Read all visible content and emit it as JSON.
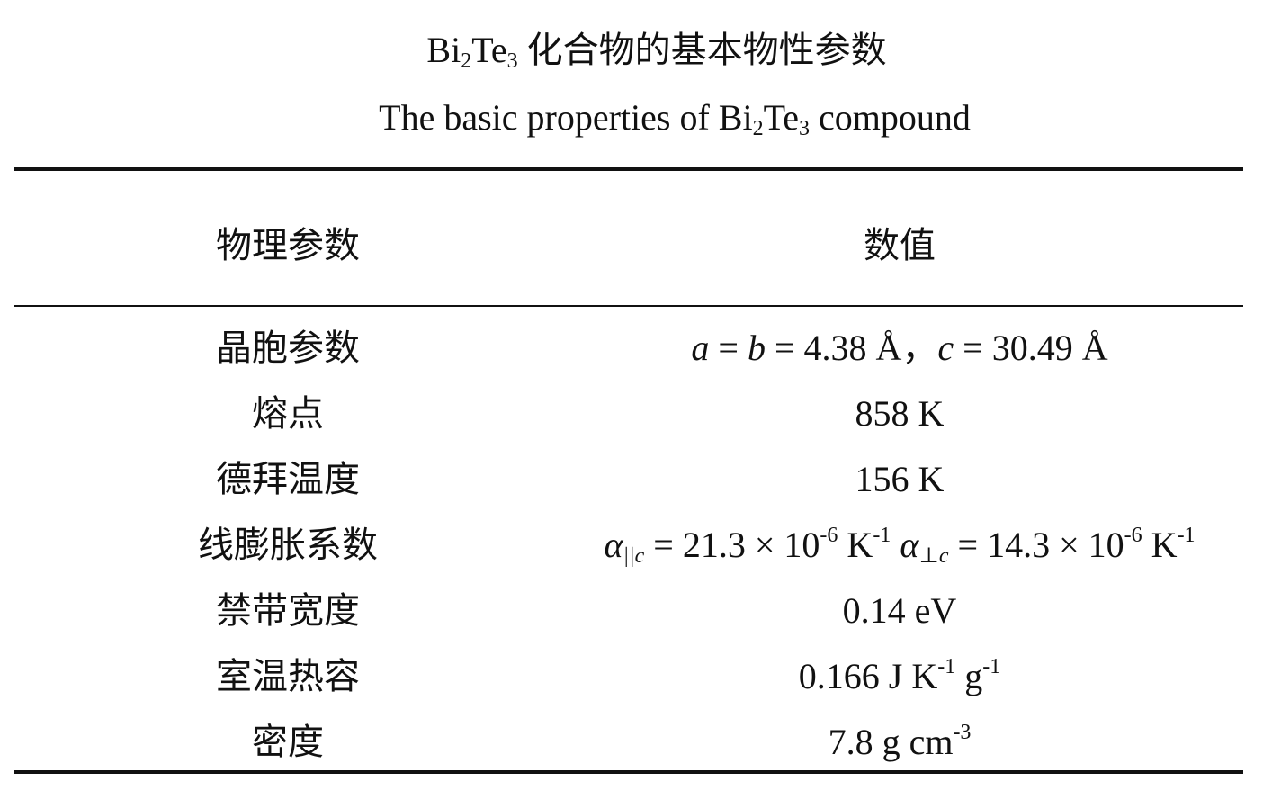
{
  "title": {
    "formula": {
      "el1": "Bi",
      "n1": "2",
      "el2": "Te",
      "n2": "3"
    },
    "cn_suffix": " 化合物的基本物性参数",
    "en_prefix": "The basic properties of ",
    "en_suffix": " compound"
  },
  "table": {
    "headers": {
      "param": "物理参数",
      "value": "数值"
    },
    "rows": [
      {
        "param": "晶胞参数",
        "value": {
          "a": "a",
          "eq1": " = ",
          "b": "b",
          "v1": " = 4.38 Å，",
          "c": "c",
          "v2": " = 30.49 Å"
        }
      },
      {
        "param": "熔点",
        "value": "858 K"
      },
      {
        "param": "德拜温度",
        "value": "156 K"
      },
      {
        "param": "线膨胀系数",
        "value": {
          "alpha": "α",
          "sub1": "||c",
          "v1": " = 21.3 × 10",
          "exp1": "-6",
          "u1": " K",
          "uexp1": "-1",
          "sp": " ",
          "alpha2": "α",
          "sub2": "⊥c",
          "v2": " = 14.3 × 10",
          "exp2": "-6",
          "u2": " K",
          "uexp2": "-1"
        }
      },
      {
        "param": "禁带宽度",
        "value": "0.14 eV"
      },
      {
        "param": "室温热容",
        "value": {
          "v": "0.166 J K",
          "exp1": "-1",
          "u": " g",
          "exp2": "-1"
        }
      },
      {
        "param": "密度",
        "value": {
          "v": "7.8 g cm",
          "exp": "-3"
        }
      }
    ]
  }
}
